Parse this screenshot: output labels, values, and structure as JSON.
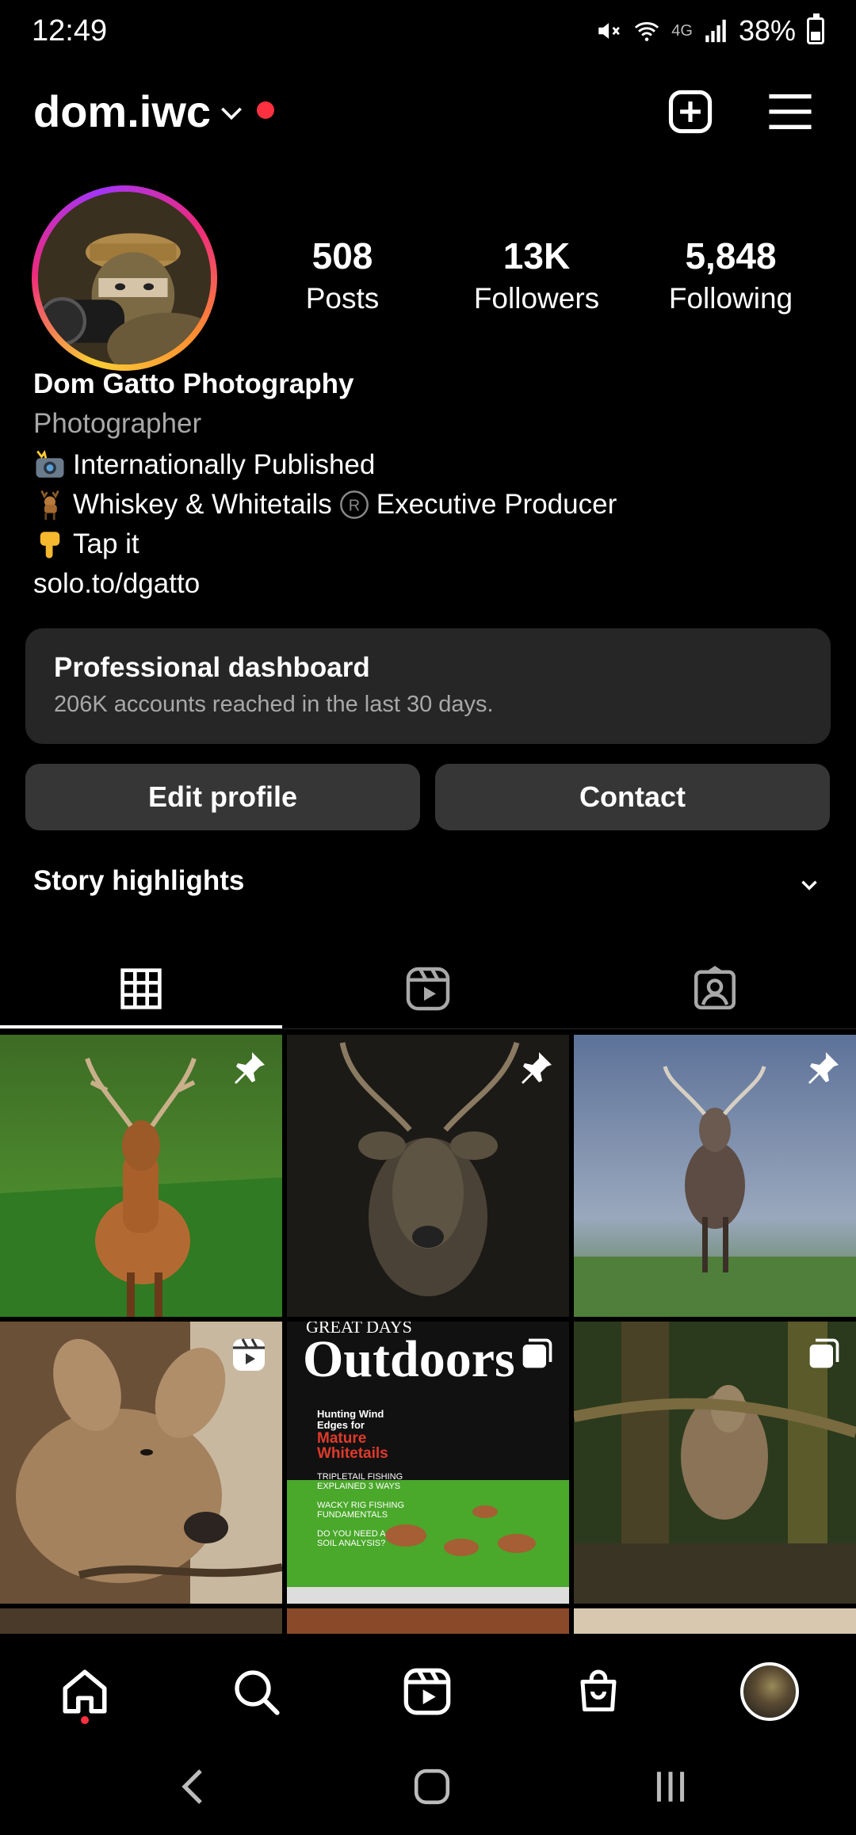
{
  "status_bar": {
    "time": "12:49",
    "network": "4G",
    "battery_percent": "38%",
    "battery_level": 0.38
  },
  "header": {
    "username": "dom.iwc"
  },
  "profile": {
    "stats": [
      {
        "value": "508",
        "label": "Posts"
      },
      {
        "value": "13K",
        "label": "Followers"
      },
      {
        "value": "5,848",
        "label": "Following"
      }
    ],
    "name": "Dom Gatto Photography",
    "category": "Photographer",
    "bio_lines": [
      "Internationally Published",
      "Whiskey & Whitetails",
      "Executive Producer",
      "Tap it"
    ],
    "link": "solo.to/dgatto"
  },
  "dashboard": {
    "title": "Professional dashboard",
    "subtitle": "206K accounts reached in the last 30 days."
  },
  "buttons": {
    "edit_profile": "Edit profile",
    "contact": "Contact"
  },
  "highlights": {
    "title": "Story highlights"
  },
  "tabs": [
    {
      "icon": "grid-icon",
      "active": true
    },
    {
      "icon": "reels-icon",
      "active": false
    },
    {
      "icon": "tagged-icon",
      "active": false
    }
  ],
  "posts": [
    {
      "badge": "pin-icon"
    },
    {
      "badge": "pin-icon"
    },
    {
      "badge": "pin-icon"
    },
    {
      "badge": "reel-icon"
    },
    {
      "badge": "carousel-icon",
      "magazine": {
        "top": "GREAT DAYS",
        "title": "Outdoors",
        "headline1": "Hunting Wind",
        "headline2": "Edges for",
        "headline3": "Mature",
        "headline4": "Whitetails",
        "line1": "TRIPLETAIL FISHING",
        "line2": "EXPLAINED 3 WAYS",
        "line3": "WACKY RIG FISHING",
        "line4": "FUNDAMENTALS",
        "line5": "DO YOU NEED A",
        "line6": "SOIL ANALYSIS?"
      }
    },
    {
      "badge": "carousel-icon"
    }
  ],
  "colors": {
    "accent_red": "#ff3040",
    "surface": "#262626",
    "button": "#363636",
    "muted_text": "#a8a8a8"
  }
}
